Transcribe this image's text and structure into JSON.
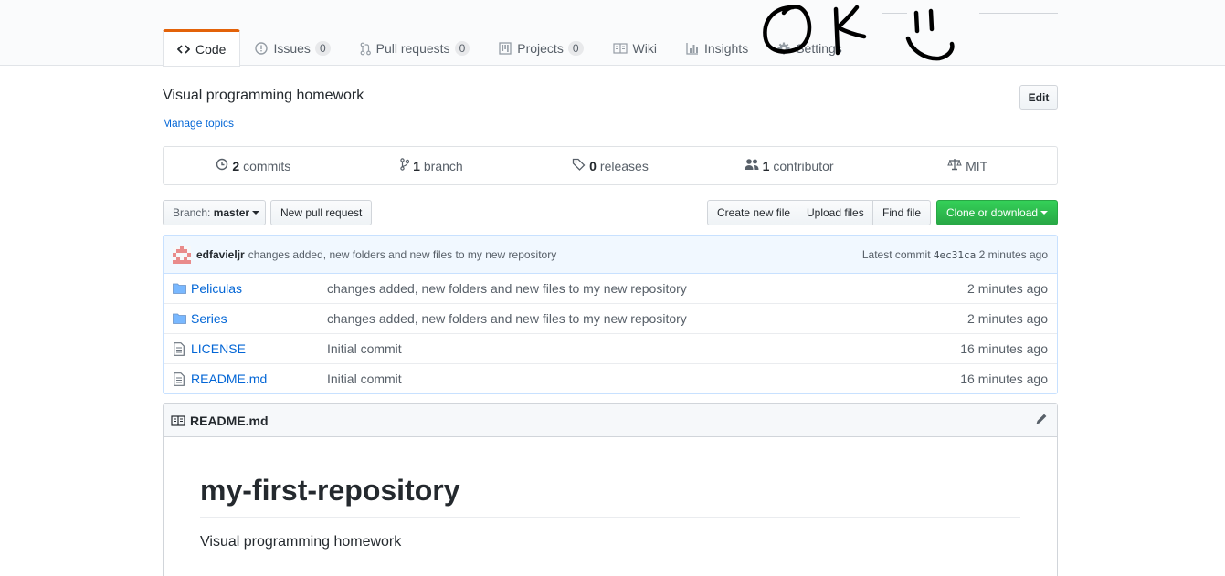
{
  "tabs": [
    {
      "label": "Code",
      "icon": "code-icon",
      "count": null,
      "selected": true
    },
    {
      "label": "Issues",
      "icon": "issue-icon",
      "count": "0"
    },
    {
      "label": "Pull requests",
      "icon": "pull-request-icon",
      "count": "0"
    },
    {
      "label": "Projects",
      "icon": "project-icon",
      "count": "0"
    },
    {
      "label": "Wiki",
      "icon": "book-icon",
      "count": null
    },
    {
      "label": "Insights",
      "icon": "graph-icon",
      "count": null
    },
    {
      "label": "Settings",
      "icon": "gear-icon",
      "count": null
    }
  ],
  "scribble_text": "OK",
  "description": "Visual programming homework",
  "manage_topics": "Manage topics",
  "edit_label": "Edit",
  "summary": {
    "commits_count": "2",
    "commits_label": "commits",
    "branch_count": "1",
    "branch_label": "branch",
    "releases_count": "0",
    "releases_label": "releases",
    "contributor_count": "1",
    "contributor_label": "contributor",
    "license": "MIT"
  },
  "toolbar": {
    "branch_prefix": "Branch:",
    "branch_name": "master",
    "new_pr": "New pull request",
    "create_file": "Create new file",
    "upload_files": "Upload files",
    "find_file": "Find file",
    "clone": "Clone or download"
  },
  "commit": {
    "author": "edfavieljr",
    "message": "changes added, new folders and new files to my new repository",
    "latest_label": "Latest commit",
    "sha": "4ec31ca",
    "age": "2 minutes ago"
  },
  "files": [
    {
      "name": "Peliculas",
      "type": "folder",
      "message": "changes added, new folders and new files to my new repository",
      "age": "2 minutes ago"
    },
    {
      "name": "Series",
      "type": "folder",
      "message": "changes added, new folders and new files to my new repository",
      "age": "2 minutes ago"
    },
    {
      "name": "LICENSE",
      "type": "file",
      "message": "Initial commit",
      "age": "16 minutes ago"
    },
    {
      "name": "README.md",
      "type": "file",
      "message": "Initial commit",
      "age": "16 minutes ago"
    }
  ],
  "readme": {
    "filename": "README.md",
    "title": "my-first-repository",
    "body": "Visual programming homework"
  },
  "colors": {
    "accent_tab": "#e36209",
    "link": "#0366d6",
    "clone_green": "#28a745"
  }
}
